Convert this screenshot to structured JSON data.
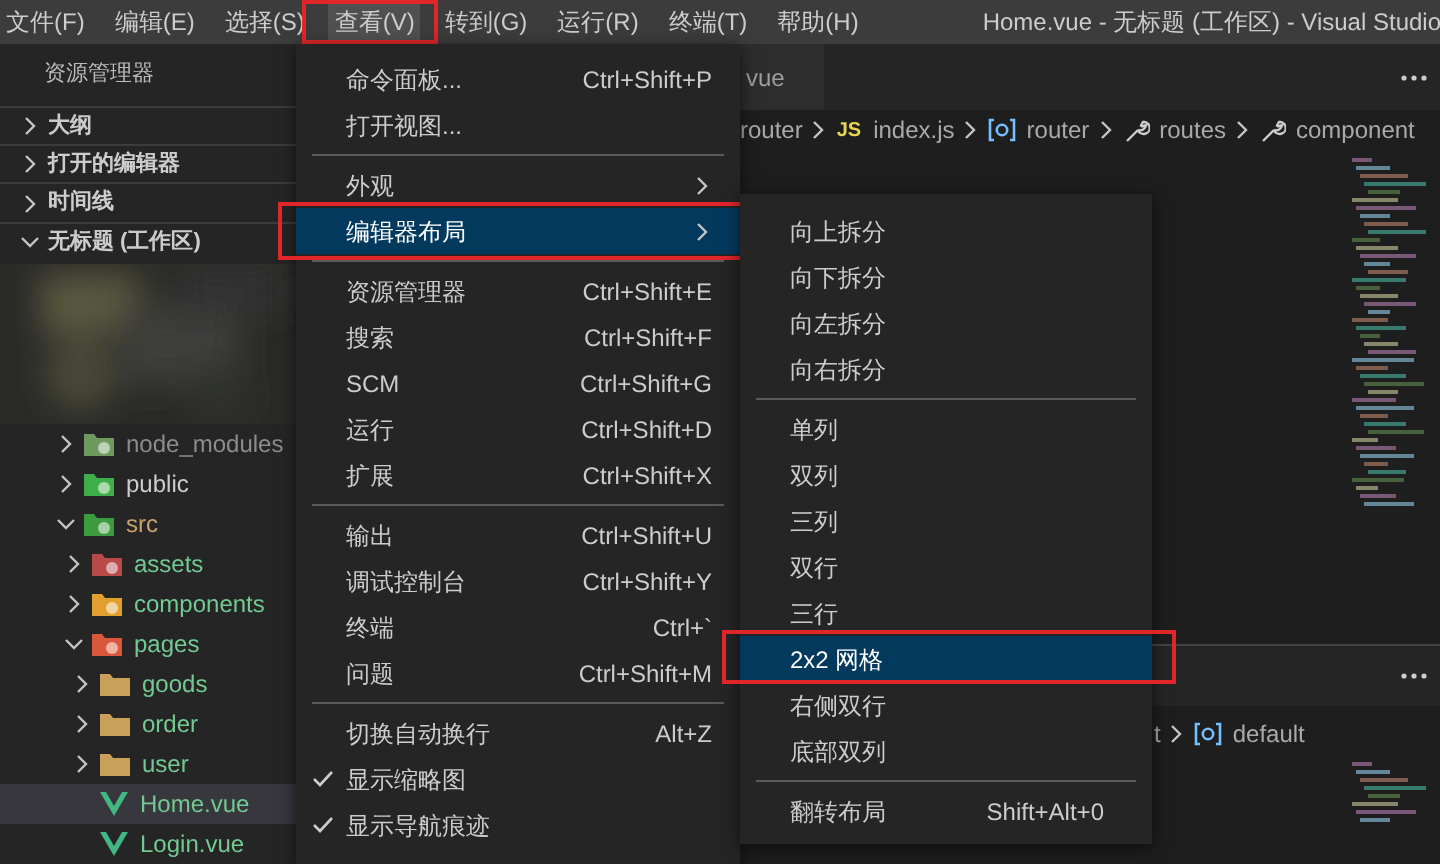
{
  "menubar": {
    "items": [
      {
        "label": "文件(F)",
        "selected": false,
        "annotated": false
      },
      {
        "label": "编辑(E)",
        "selected": false,
        "annotated": false
      },
      {
        "label": "选择(S)",
        "selected": false,
        "annotated": false
      },
      {
        "label": "查看(V)",
        "selected": true,
        "annotated": true
      },
      {
        "label": "转到(G)",
        "selected": false,
        "annotated": false
      },
      {
        "label": "运行(R)",
        "selected": false,
        "annotated": false
      },
      {
        "label": "终端(T)",
        "selected": false,
        "annotated": false
      },
      {
        "label": "帮助(H)",
        "selected": false,
        "annotated": false
      }
    ],
    "window_title": "Home.vue - 无标题 (工作区) - Visual Studio"
  },
  "sidebar": {
    "title": "资源管理器",
    "sections": [
      {
        "label": "大纲",
        "expanded": false
      },
      {
        "label": "打开的编辑器",
        "expanded": false
      },
      {
        "label": "时间线",
        "expanded": false
      },
      {
        "label": "无标题 (工作区)",
        "expanded": true
      }
    ],
    "tree": [
      {
        "label": "node_modules",
        "kind": "folder",
        "color": "#8c8c8c",
        "expanded": false,
        "selected": false
      },
      {
        "label": "public",
        "kind": "folder",
        "color": "#cccccc",
        "expanded": false,
        "selected": false
      },
      {
        "label": "src",
        "kind": "folder",
        "color": "#c9a26d",
        "expanded": true,
        "selected": false,
        "children": [
          {
            "label": "assets",
            "kind": "folder",
            "color": "#73c991",
            "expanded": false,
            "selected": false
          },
          {
            "label": "components",
            "kind": "folder",
            "color": "#73c991",
            "expanded": false,
            "selected": false
          },
          {
            "label": "pages",
            "kind": "folder",
            "color": "#73c991",
            "expanded": true,
            "selected": false,
            "children": [
              {
                "label": "goods",
                "kind": "folder",
                "color": "#73c991",
                "expanded": false,
                "selected": false
              },
              {
                "label": "order",
                "kind": "folder",
                "color": "#73c991",
                "expanded": false,
                "selected": false
              },
              {
                "label": "user",
                "kind": "folder",
                "color": "#73c991",
                "expanded": false,
                "selected": false
              },
              {
                "label": "Home.vue",
                "kind": "file",
                "color": "#73c991",
                "selected": true
              },
              {
                "label": "Login.vue",
                "kind": "file",
                "color": "#73c991",
                "selected": false
              }
            ]
          }
        ]
      }
    ]
  },
  "editor_groups": [
    {
      "tab": "vue",
      "breadcrumb": [
        {
          "label": "router",
          "kind": "folder"
        },
        {
          "label": "index.js",
          "kind": "file",
          "tag": "JS"
        },
        {
          "label": "router",
          "kind": "variable"
        },
        {
          "label": "routes",
          "kind": "property"
        },
        {
          "label": "component",
          "kind": "property"
        }
      ]
    },
    {
      "breadcrumb": [
        {
          "label": "t",
          "kind": "folder"
        },
        {
          "label": "default",
          "kind": "variable"
        }
      ]
    }
  ],
  "view_menu": {
    "items": [
      {
        "kind": "item",
        "label": "命令面板...",
        "shortcut": "Ctrl+Shift+P"
      },
      {
        "kind": "item",
        "label": "打开视图..."
      },
      {
        "kind": "separator"
      },
      {
        "kind": "submenu",
        "label": "外观",
        "selected": false,
        "annotated": false
      },
      {
        "kind": "submenu",
        "label": "编辑器布局",
        "selected": true,
        "annotated": true
      },
      {
        "kind": "separator"
      },
      {
        "kind": "item",
        "label": "资源管理器",
        "shortcut": "Ctrl+Shift+E"
      },
      {
        "kind": "item",
        "label": "搜索",
        "shortcut": "Ctrl+Shift+F"
      },
      {
        "kind": "item",
        "label": "SCM",
        "shortcut": "Ctrl+Shift+G"
      },
      {
        "kind": "item",
        "label": "运行",
        "shortcut": "Ctrl+Shift+D"
      },
      {
        "kind": "item",
        "label": "扩展",
        "shortcut": "Ctrl+Shift+X"
      },
      {
        "kind": "separator"
      },
      {
        "kind": "item",
        "label": "输出",
        "shortcut": "Ctrl+Shift+U"
      },
      {
        "kind": "item",
        "label": "调试控制台",
        "shortcut": "Ctrl+Shift+Y"
      },
      {
        "kind": "item",
        "label": "终端",
        "shortcut": "Ctrl+`"
      },
      {
        "kind": "item",
        "label": "问题",
        "shortcut": "Ctrl+Shift+M"
      },
      {
        "kind": "separator"
      },
      {
        "kind": "item",
        "label": "切换自动换行",
        "shortcut": "Alt+Z",
        "checked": false
      },
      {
        "kind": "item",
        "label": "显示缩略图",
        "checked": true
      },
      {
        "kind": "item",
        "label": "显示导航痕迹",
        "checked": true
      }
    ]
  },
  "layout_submenu": {
    "items": [
      {
        "kind": "item",
        "label": "向上拆分",
        "selected": false,
        "annotated": false
      },
      {
        "kind": "item",
        "label": "向下拆分",
        "selected": false,
        "annotated": false
      },
      {
        "kind": "item",
        "label": "向左拆分",
        "selected": false,
        "annotated": false
      },
      {
        "kind": "item",
        "label": "向右拆分",
        "selected": false,
        "annotated": false
      },
      {
        "kind": "separator"
      },
      {
        "kind": "item",
        "label": "单列",
        "selected": false,
        "annotated": false
      },
      {
        "kind": "item",
        "label": "双列",
        "selected": false,
        "annotated": false
      },
      {
        "kind": "item",
        "label": "三列",
        "selected": false,
        "annotated": false
      },
      {
        "kind": "item",
        "label": "双行",
        "selected": false,
        "annotated": false
      },
      {
        "kind": "item",
        "label": "三行",
        "selected": false,
        "annotated": false
      },
      {
        "kind": "item",
        "label": "2x2 网格",
        "selected": true,
        "annotated": true
      },
      {
        "kind": "item",
        "label": "右侧双行",
        "selected": false,
        "annotated": false
      },
      {
        "kind": "item",
        "label": "底部双列",
        "selected": false,
        "annotated": false
      },
      {
        "kind": "separator"
      },
      {
        "kind": "item",
        "label": "翻转布局",
        "shortcut": "Shift+Alt+0",
        "selected": false,
        "annotated": false
      }
    ]
  }
}
